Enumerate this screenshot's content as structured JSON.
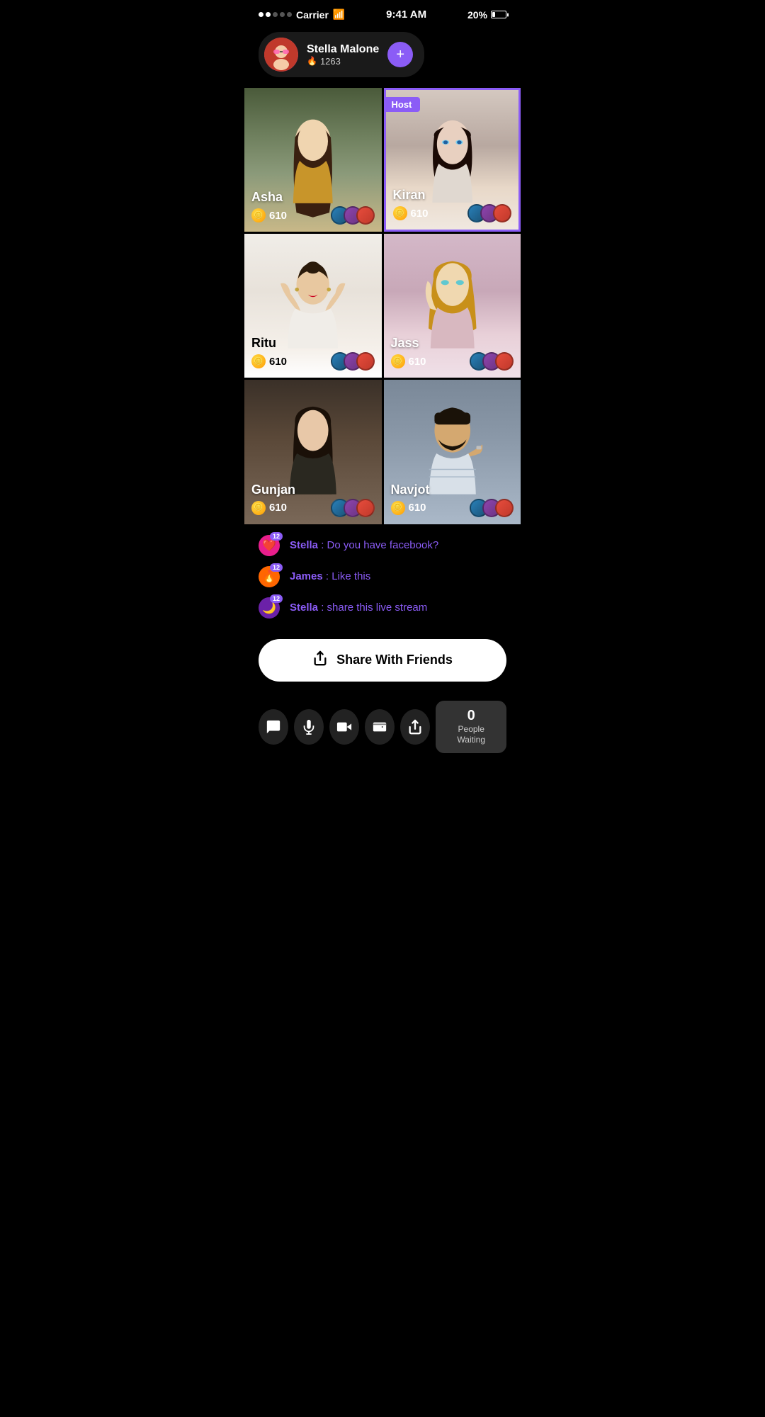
{
  "statusBar": {
    "carrier": "Carrier",
    "time": "9:41 AM",
    "battery": "20%",
    "signal": [
      true,
      true,
      false,
      false,
      false
    ]
  },
  "userHeader": {
    "name": "Stella Malone",
    "score": "1263",
    "addBtn": "+"
  },
  "grid": [
    {
      "id": "asha",
      "name": "Asha",
      "coins": "610",
      "isHost": false,
      "bgClass": "bg-asha"
    },
    {
      "id": "kiran",
      "name": "Kiran",
      "coins": "610",
      "isHost": true,
      "bgClass": "bg-kiran"
    },
    {
      "id": "ritu",
      "name": "Ritu",
      "coins": "610",
      "isHost": false,
      "bgClass": "bg-ritu"
    },
    {
      "id": "jass",
      "name": "Jass",
      "coins": "610",
      "isHost": false,
      "bgClass": "bg-jass"
    },
    {
      "id": "gunjan",
      "name": "Gunjan",
      "coins": "610",
      "isHost": false,
      "bgClass": "bg-gunjan"
    },
    {
      "id": "navjot",
      "name": "Navjot",
      "coins": "610",
      "isHost": false,
      "bgClass": "bg-navjot"
    }
  ],
  "hostLabel": "Host",
  "chat": {
    "messages": [
      {
        "user": "Stella",
        "badgeEmoji": "❤️",
        "badgeColor": "#e91e8c",
        "badgeNum": "12",
        "message": "Do you have facebook?",
        "messageColor": "#8b5cf6"
      },
      {
        "user": "James",
        "badgeEmoji": "🔥",
        "badgeColor": "#ff6600",
        "badgeNum": "12",
        "message": "Like this",
        "messageColor": "#8b5cf6"
      },
      {
        "user": "Stella",
        "badgeEmoji": "🌙",
        "badgeColor": "#6b21a8",
        "badgeNum": "12",
        "message": "share this live stream",
        "messageColor": "#8b5cf6"
      }
    ]
  },
  "shareBtn": {
    "label": "Share With Friends",
    "icon": "share"
  },
  "bottomBar": {
    "buttons": [
      {
        "icon": "chat",
        "label": "chat"
      },
      {
        "icon": "mic",
        "label": "microphone"
      },
      {
        "icon": "video",
        "label": "video"
      },
      {
        "icon": "wallet",
        "label": "wallet"
      },
      {
        "icon": "share",
        "label": "share"
      }
    ]
  },
  "peopleWaiting": {
    "count": "0",
    "label": "People Waiting"
  }
}
